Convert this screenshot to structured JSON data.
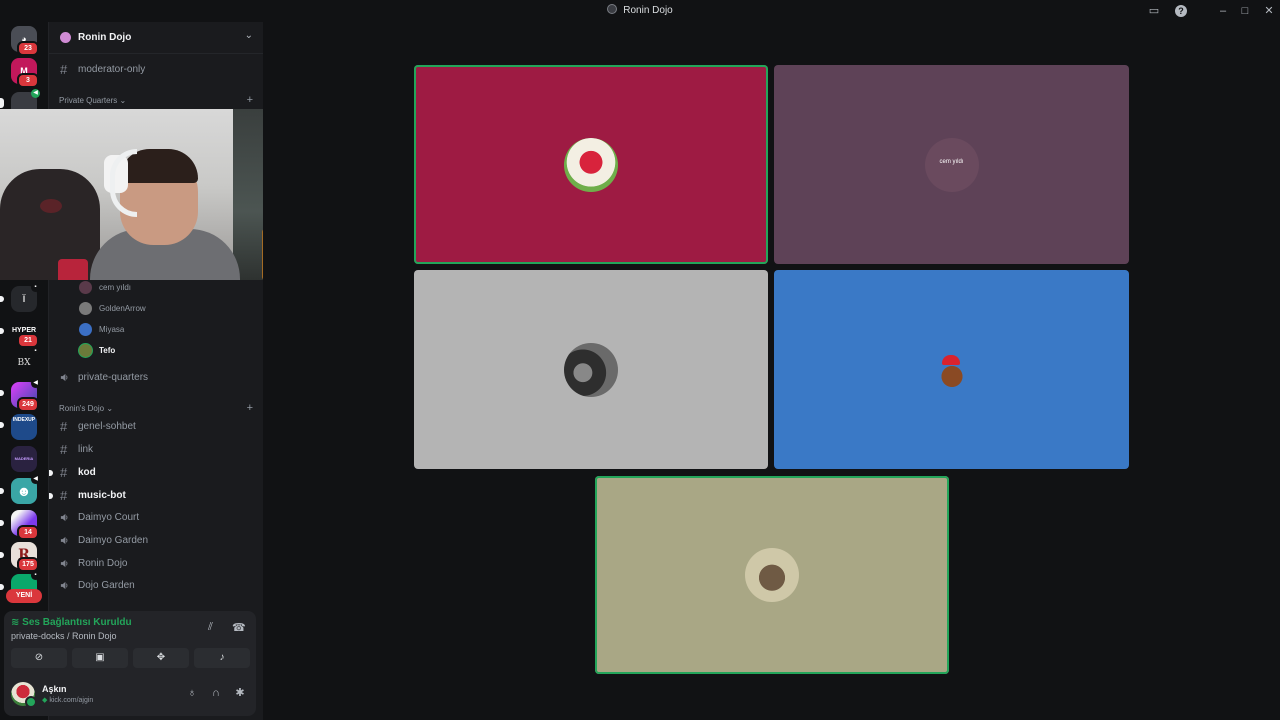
{
  "window": {
    "title": "Ronin Dojo"
  },
  "servers": [
    {
      "name": "discord-home",
      "badge": "23",
      "color": "#4a4d55"
    },
    {
      "name": "server-m",
      "badge": "3",
      "color": "#c2185b"
    },
    {
      "name": "server-voice-active",
      "badge": "",
      "color": "#3a3c42"
    },
    {
      "name": "server-mic",
      "badge": "",
      "color": "#26282c"
    },
    {
      "name": "server-hyper",
      "label": "HYPER",
      "badge": "21",
      "color": "#111214"
    },
    {
      "name": "server-bx",
      "label": "BX",
      "badge": "",
      "color": "#111214"
    },
    {
      "name": "server-purple",
      "badge": "249",
      "color": "#8e44ad"
    },
    {
      "name": "server-indexup",
      "label": "INDEXUP",
      "badge": "",
      "color": "#1e4a8a"
    },
    {
      "name": "server-maderia",
      "label": "MADERIA",
      "badge": "",
      "color": "#2a2240"
    },
    {
      "name": "server-ghost",
      "badge": "",
      "color": "#3aa6a6"
    },
    {
      "name": "server-pink",
      "badge": "14",
      "color": "#7c3aed"
    },
    {
      "name": "server-r",
      "label": "R",
      "badge": "175",
      "color": "#e8e0da"
    },
    {
      "name": "server-green",
      "badge": "",
      "color": "#0aa86b"
    }
  ],
  "yeni_label": "YENİ",
  "guild": {
    "name": "Ronin Dojo"
  },
  "channels_top": [
    {
      "name": "moderator-only",
      "type": "text"
    }
  ],
  "category_private": "Private Quarters",
  "voice_members": [
    {
      "name": "cem yıldı",
      "color": "#5a3a4a"
    },
    {
      "name": "GoldenArrow",
      "color": "#7a7a7a"
    },
    {
      "name": "Miyasa",
      "color": "#3b6fc4"
    },
    {
      "name": "Tefo",
      "color": "#6b7a3a"
    }
  ],
  "channel_private_quarters": "private-quarters",
  "category_ronins": "Ronin's Dojo",
  "channels": [
    {
      "name": "genel-sohbet",
      "type": "text",
      "bold": false
    },
    {
      "name": "link",
      "type": "text",
      "bold": false
    },
    {
      "name": "kod",
      "type": "text",
      "bold": true
    },
    {
      "name": "music-bot",
      "type": "text",
      "bold": true
    },
    {
      "name": "Daimyo Court",
      "type": "voice",
      "bold": false
    },
    {
      "name": "Daimyo Garden",
      "type": "voice",
      "bold": false
    },
    {
      "name": "Ronin Dojo",
      "type": "voice",
      "bold": false
    },
    {
      "name": "Dojo Garden",
      "type": "voice",
      "bold": false
    }
  ],
  "voice_status": {
    "title": "Ses Bağlantısı Kuruldu",
    "subtitle": "private-docks / Ronin Dojo"
  },
  "user": {
    "name": "Aşkın",
    "status": "kick.com/ajgin"
  },
  "stage": {
    "tiles": [
      {
        "name": "participant-1",
        "bg": "#9e1b43",
        "speaking": true,
        "avatar": "#e8e0d0"
      },
      {
        "name": "participant-cem",
        "bg": "#5e4257",
        "speaking": false,
        "avatar": "#6a4a5e",
        "caption": "cem yıldı"
      },
      {
        "name": "participant-3",
        "bg": "#b4b4b4",
        "speaking": false,
        "avatar": "#4a4a4a"
      },
      {
        "name": "participant-4",
        "bg": "#3a79c6",
        "speaking": false,
        "avatar": "#3a79c6"
      },
      {
        "name": "participant-5",
        "bg": "#a9a785",
        "speaking": true,
        "avatar": "#cfc8a8"
      }
    ]
  },
  "colors": {
    "green": "#23a55a",
    "red_badge": "#da373c"
  }
}
